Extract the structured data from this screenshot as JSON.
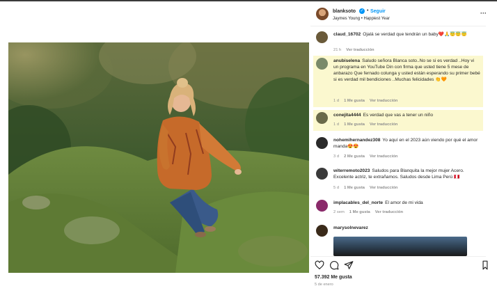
{
  "post": {
    "author": "blanksoto",
    "follow_label": "Seguir",
    "dot": "•",
    "audio": "Jaymes Young • Happiest Year",
    "more": "···"
  },
  "comments": [
    {
      "user": "claud_16702",
      "text": "Ojalá se verdad que tendrán un baby❤️🙏😇😇😇",
      "time": "21 h",
      "likes": "",
      "translate": "Ver traducción",
      "highlighted": false,
      "avatar_color": "#6a5a3a"
    },
    {
      "user": "anubiselena",
      "text": "Saludo señora Blanca soto..No se si es verdad ..Hoy vi un programa en YouTube Din con firma que usted tiene 5 mese de anbarazo Que fernado colunga y usted están esperando su primer bebé si es verdad mil bendiciones ..Muchas felicidades 👏🧡",
      "time": "1 d",
      "likes": "1 Me gusta",
      "translate": "Ver traducción",
      "highlighted": true,
      "avatar_color": "#7a8a6a"
    },
    {
      "user": "conejita4444",
      "text": "Es verdad que vas a tener un niño",
      "time": "1 d",
      "likes": "1 Me gusta",
      "translate": "Ver traducción",
      "highlighted": true,
      "avatar_color": "#6a6a4a"
    },
    {
      "user": "nohemihernandez308",
      "text": "Yo aquí en el 2023 aún viendo por qué el amor manda😍😍",
      "time": "3 d",
      "likes": "2 Me gusta",
      "translate": "Ver traducción",
      "highlighted": false,
      "avatar_color": "#2a2a2a"
    },
    {
      "user": "witerremoto2023",
      "text": "Saludos para Blanquita la mejor mujer Acero. Excelente actriz, te extrañamos. Saludos desde Lima Perú 🇵🇪",
      "time": "5 d",
      "likes": "1 Me gusta",
      "translate": "Ver traducción",
      "highlighted": false,
      "avatar_color": "#3a3a3a"
    },
    {
      "user": "implacables_del_norte",
      "text": "El amor de mi vida",
      "time": "2 sem",
      "likes": "1 Me gusta",
      "translate": "Ver traducción",
      "highlighted": false,
      "avatar_color": "#8a2a6a"
    },
    {
      "user": "marysolnevarez",
      "text": "",
      "time": "",
      "likes": "",
      "translate": "",
      "highlighted": false,
      "avatar_color": "#3a2a1a"
    }
  ],
  "actions": {
    "likes": "57.392 Me gusta",
    "date": "5 de enero",
    "icons": [
      "heart-icon",
      "comment-icon",
      "share-icon",
      "bookmark-icon"
    ]
  },
  "colors": {
    "accent": "#0095f6",
    "highlight": "#fbf8cf",
    "muted": "#8e8e8e",
    "text": "#262626"
  }
}
